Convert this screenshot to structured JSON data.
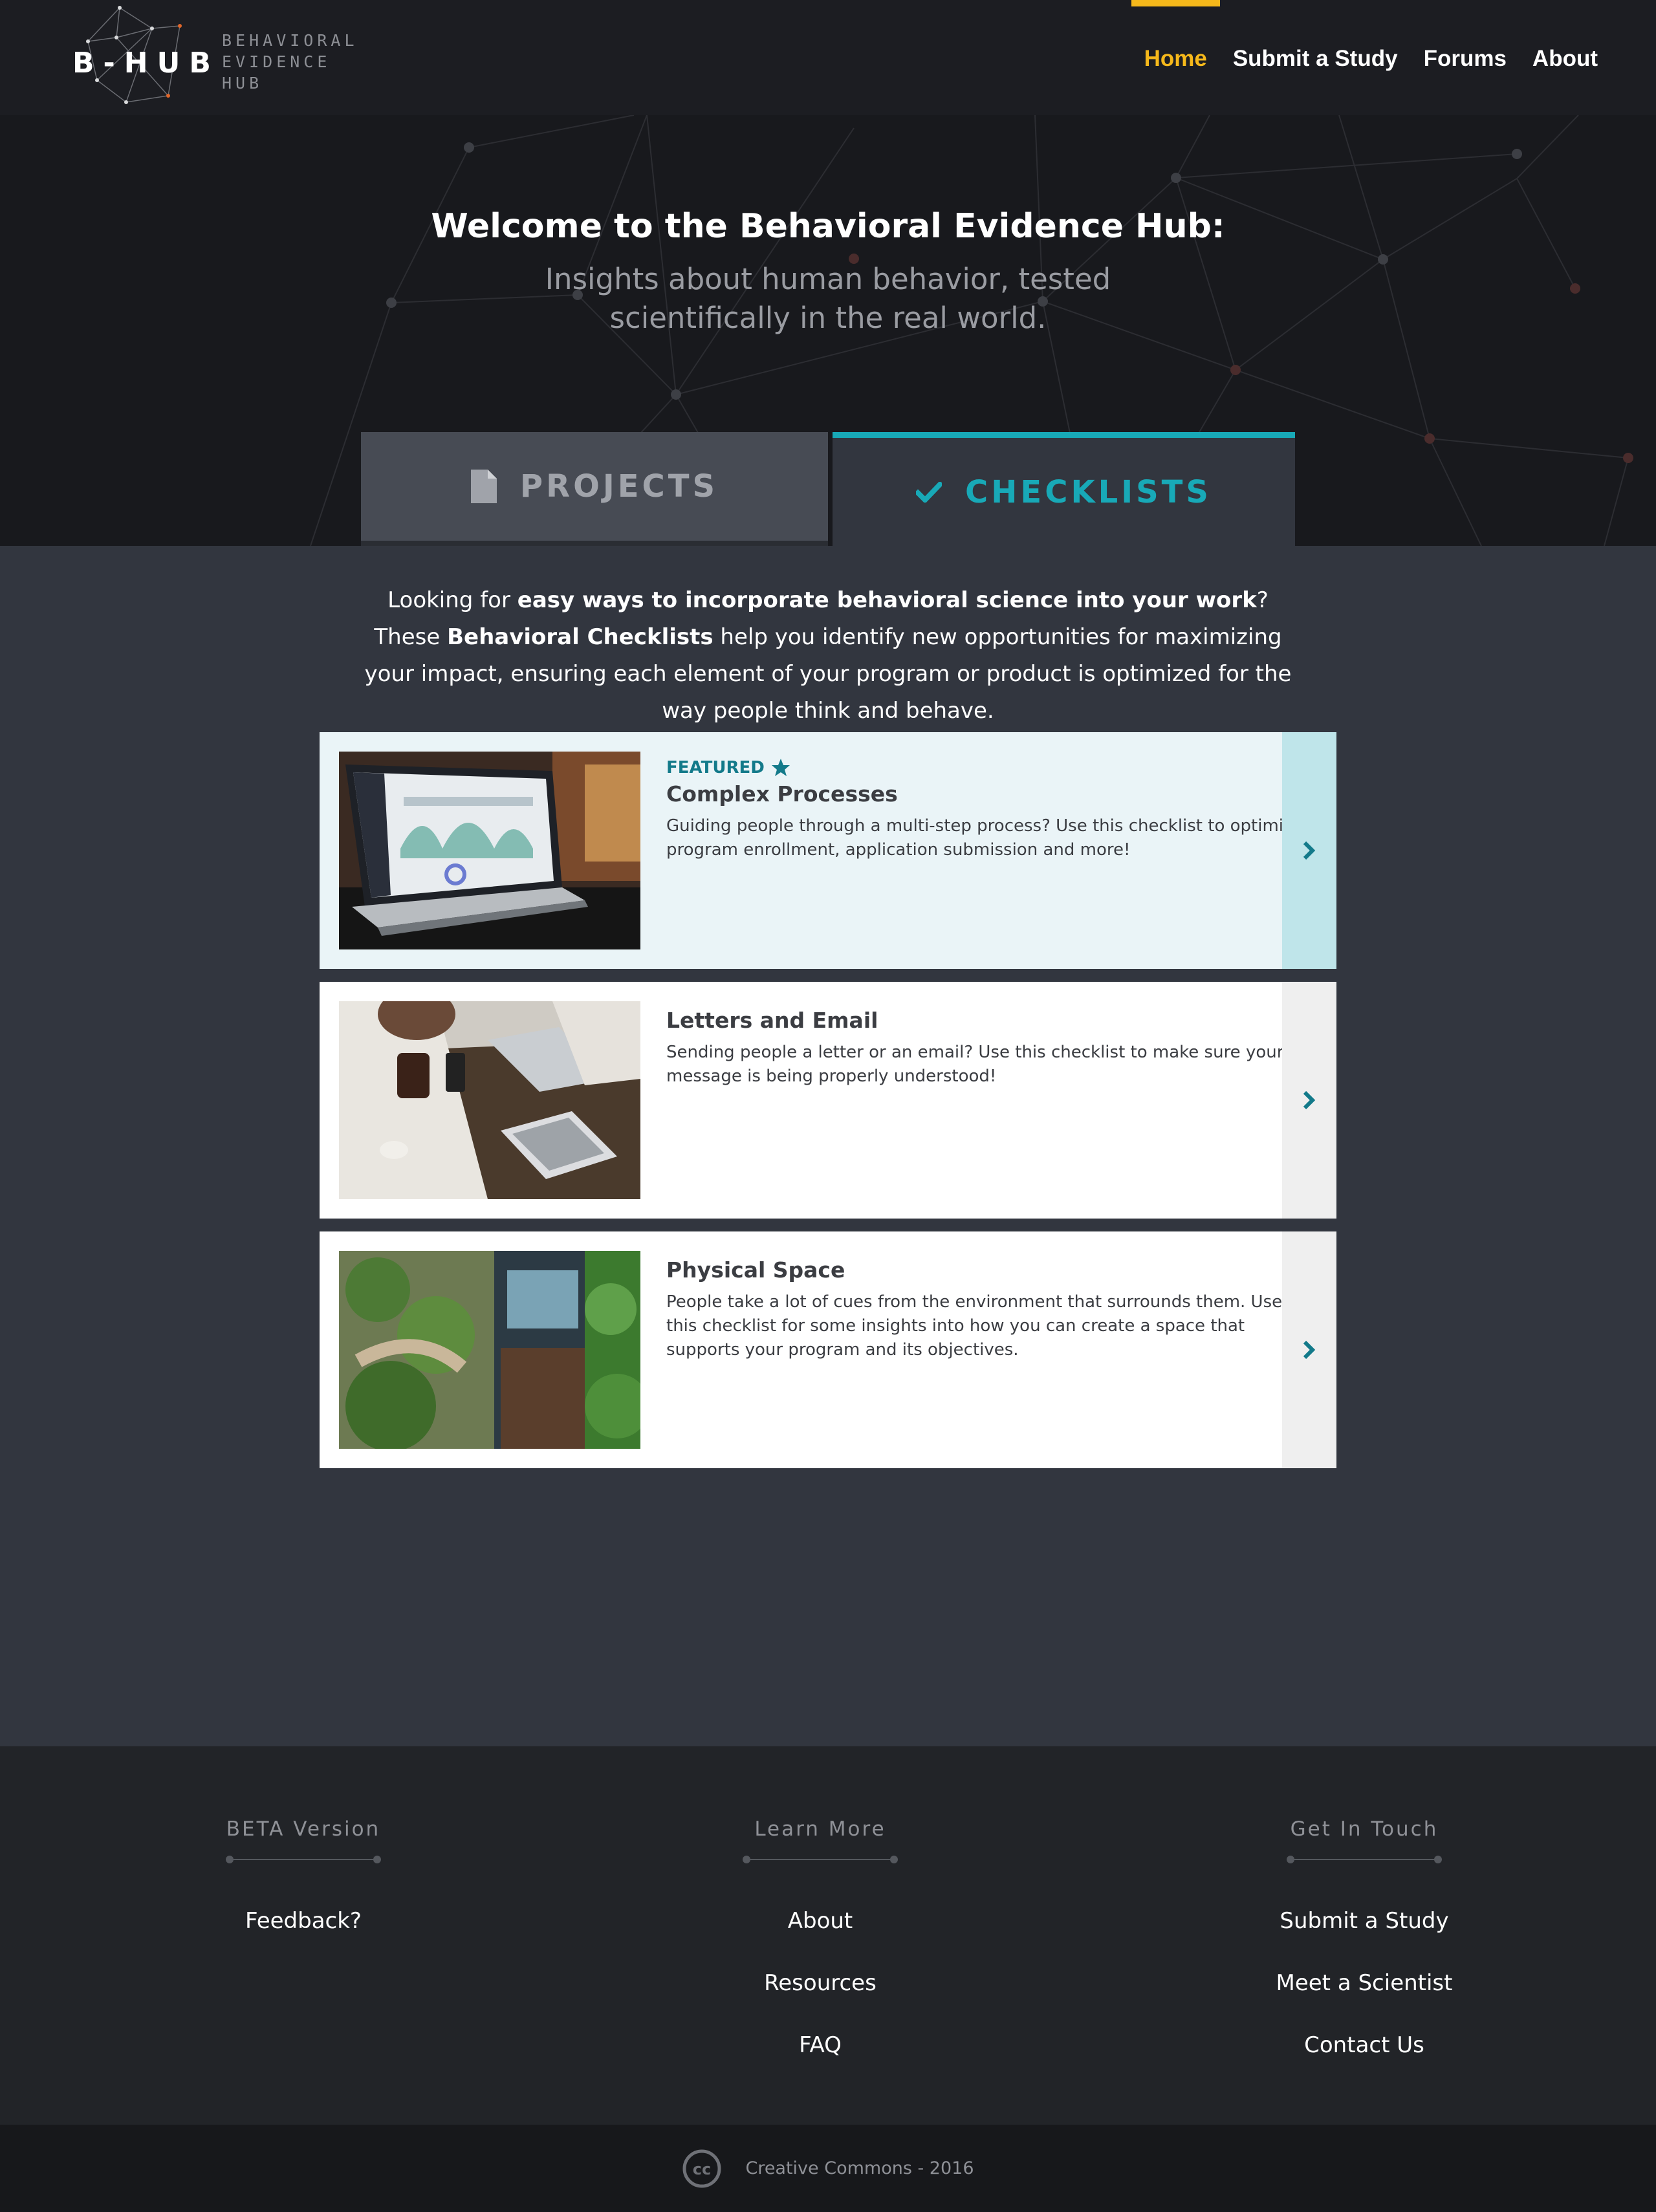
{
  "header": {
    "logo_text": "B-HUB",
    "logo_sub": [
      "BEHAVIORAL",
      "EVIDENCE",
      "HUB"
    ],
    "nav": [
      {
        "label": "Home",
        "active": true
      },
      {
        "label": "Submit a Study"
      },
      {
        "label": "Forums"
      },
      {
        "label": "About"
      }
    ]
  },
  "hero": {
    "title": "Welcome to the Behavioral Evidence Hub:",
    "subtitle": "Insights about human behavior, tested scientifically in the real world."
  },
  "tabs": [
    {
      "label": "PROJECTS",
      "icon": "file-icon",
      "active": false
    },
    {
      "label": "CHECKLISTS",
      "icon": "check-icon",
      "active": true
    }
  ],
  "intro": {
    "p1": "Looking for ",
    "b1": "easy ways to incorporate behavioral science into your work",
    "p2": "? These ",
    "b2": "Behavioral Checklists",
    "p3": " help you identify new opportunities for maximizing your impact, ensuring each element of your program or product is optimized for the way people think and behave."
  },
  "cards": [
    {
      "featured_label": "FEATURED",
      "title": "Complex Processes",
      "description": "Guiding people through a multi-step process? Use this checklist to optimize program enrollment, application submission and more!",
      "image": "laptop-dashboard-photo"
    },
    {
      "title": "Letters and Email",
      "description": "Sending people a letter or an email? Use this checklist to make sure your message is being properly understood!",
      "image": "cafe-devices-photo"
    },
    {
      "title": "Physical Space",
      "description": "People take a lot of cues from the environment that surrounds them. Use this checklist for some insights into how you can create a space that supports your program and its objectives.",
      "image": "studio-garden-photo"
    }
  ],
  "footer": {
    "columns": [
      {
        "heading": "BETA Version",
        "links": [
          "Feedback?"
        ]
      },
      {
        "heading": "Learn More",
        "links": [
          "About",
          "Resources",
          "FAQ"
        ]
      },
      {
        "heading": "Get In Touch",
        "links": [
          "Submit a Study",
          "Meet a Scientist",
          "Contact Us"
        ]
      }
    ],
    "copyright": "Creative Commons - 2016",
    "copyright_icon": "cc-icon"
  },
  "colors": {
    "accent": "#f5b81b",
    "teal": "#18a9b7",
    "dark": "#1c1d22",
    "body": "#32363f"
  }
}
